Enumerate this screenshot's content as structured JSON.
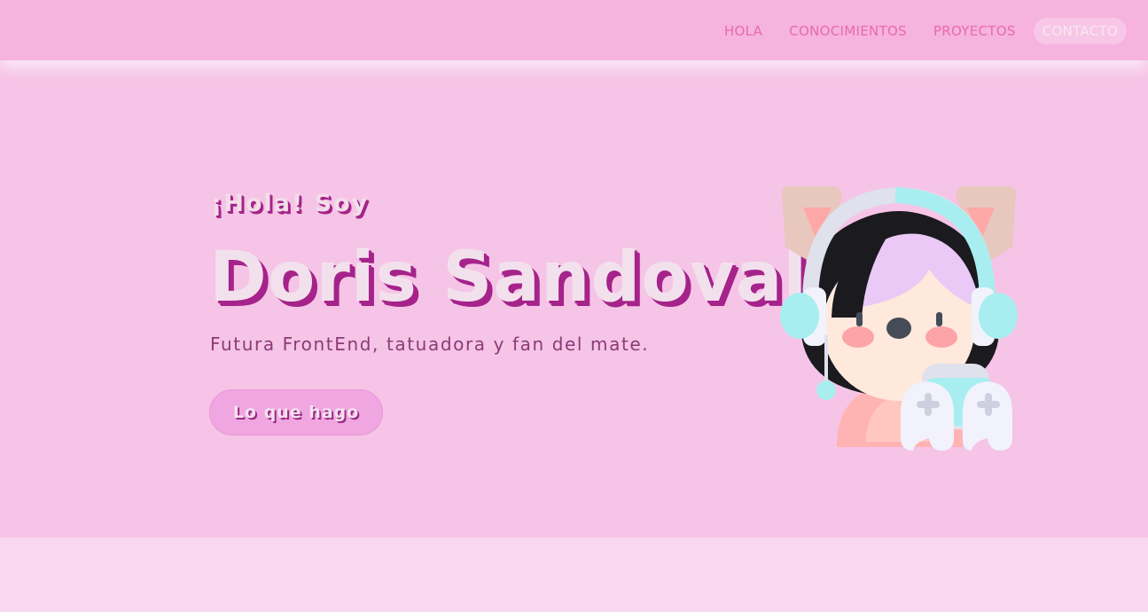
{
  "nav": {
    "links": [
      "HOLA",
      "CONOCIMIENTOS",
      "PROYECTOS",
      "CONTACTO"
    ],
    "active": "CONTACTO"
  },
  "hero": {
    "greeting": "¡Hola! Soy",
    "name": "Doris Sandoval",
    "tagline": "Futura FrontEnd, tatuadora y fan del mate.",
    "cta_label": "Lo que hago",
    "avatar_icon": "gamer-girl-avatar-icon"
  },
  "colors": {
    "nav_bg": "#f5b3de",
    "hero_bg": "#f6c4e6",
    "accent_shadow": "#a5238a",
    "nav_text": "#e86ab0",
    "button_bg": "#f0a6e0"
  }
}
